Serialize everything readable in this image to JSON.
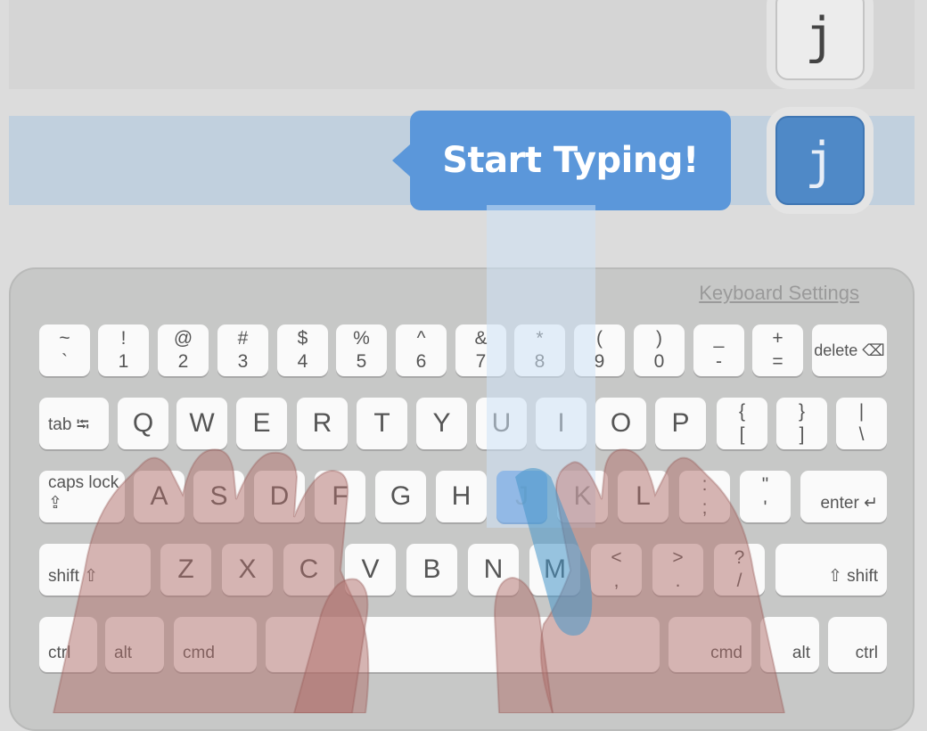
{
  "rows": {
    "row1_letter": "j",
    "row2_letter": "j"
  },
  "tooltip": {
    "text": "Start Typing!"
  },
  "keyboard": {
    "settings_label": "Keyboard Settings",
    "number_row": [
      {
        "top": "~",
        "bottom": "`"
      },
      {
        "top": "!",
        "bottom": "1"
      },
      {
        "top": "@",
        "bottom": "2"
      },
      {
        "top": "#",
        "bottom": "3"
      },
      {
        "top": "$",
        "bottom": "4"
      },
      {
        "top": "%",
        "bottom": "5"
      },
      {
        "top": "^",
        "bottom": "6"
      },
      {
        "top": "&",
        "bottom": "7"
      },
      {
        "top": "*",
        "bottom": "8"
      },
      {
        "top": "(",
        "bottom": "9"
      },
      {
        "top": ")",
        "bottom": "0"
      },
      {
        "top": "_",
        "bottom": "-"
      },
      {
        "top": "+",
        "bottom": "="
      }
    ],
    "delete_label": "delete ⌫",
    "tab_label": "tab ⭾",
    "top_row": [
      "Q",
      "W",
      "E",
      "R",
      "T",
      "Y",
      "U",
      "I",
      "O",
      "P"
    ],
    "top_row_symbols": [
      {
        "top": "{",
        "bottom": "["
      },
      {
        "top": "}",
        "bottom": "]"
      },
      {
        "top": "|",
        "bottom": "\\"
      }
    ],
    "caps_label": "caps lock ⇪",
    "home_row": [
      "A",
      "S",
      "D",
      "F",
      "G",
      "H",
      "J",
      "K",
      "L"
    ],
    "home_row_symbols": [
      {
        "top": ":",
        "bottom": ";"
      },
      {
        "top": "\"",
        "bottom": "'"
      }
    ],
    "enter_label": "enter ↵",
    "shift_left_label": "shift ⇧",
    "bottom_row": [
      "Z",
      "X",
      "C",
      "V",
      "B",
      "N",
      "M"
    ],
    "bottom_row_symbols": [
      {
        "top": "<",
        "bottom": ","
      },
      {
        "top": ">",
        "bottom": "."
      },
      {
        "top": "?",
        "bottom": "/"
      }
    ],
    "shift_right_label": "⇧ shift",
    "ctrl_left": "ctrl",
    "alt_left": "alt",
    "cmd_left": "cmd",
    "cmd_right": "cmd",
    "alt_right": "alt",
    "ctrl_right": "ctrl",
    "active_key": "J",
    "colors": {
      "accent": "#4a88d2",
      "tooltip": "#5b97da"
    }
  }
}
